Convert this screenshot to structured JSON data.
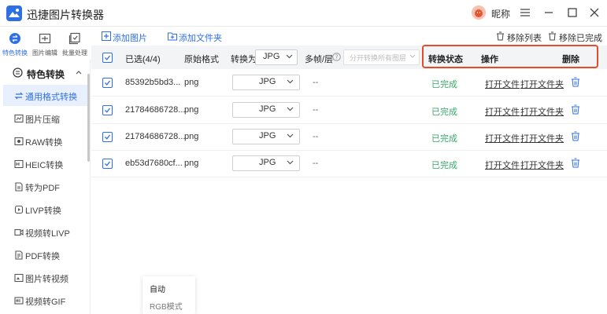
{
  "app": {
    "title": "迅捷图片转换器",
    "nickname": "昵称"
  },
  "colors": {
    "accent": "#2f6fe4",
    "success": "#38a86b",
    "highlight": "#e44b2c"
  },
  "top_nav": [
    {
      "label": "特色转换",
      "icon": "magic-convert-icon",
      "active": true
    },
    {
      "label": "图片编辑",
      "icon": "image-edit-icon",
      "active": false
    },
    {
      "label": "批量处理",
      "icon": "batch-process-icon",
      "active": false
    }
  ],
  "sidebar": {
    "section": "特色转换",
    "items": [
      {
        "label": "通用格式转换",
        "icon": "swap-icon"
      },
      {
        "label": "图片压缩",
        "icon": "compress-icon"
      },
      {
        "label": "RAW转换",
        "icon": "raw-icon"
      },
      {
        "label": "HEIC转换",
        "icon": "heic-icon"
      },
      {
        "label": "转为PDF",
        "icon": "pdf-icon"
      },
      {
        "label": "LIVP转换",
        "icon": "livp-icon"
      },
      {
        "label": "视频转LIVP",
        "icon": "video-icon"
      },
      {
        "label": "PDF转换",
        "icon": "pdf-convert-icon"
      },
      {
        "label": "图片转视频",
        "icon": "image-video-icon"
      },
      {
        "label": "视频转GIF",
        "icon": "gif-icon"
      }
    ]
  },
  "toolbar": {
    "add_image": "添加图片",
    "add_folder": "添加文件夹",
    "remove_list": "移除列表",
    "remove_done": "移除已完成"
  },
  "table": {
    "selected": "已选(4/4)",
    "col_format": "原始格式",
    "col_convert": "转换为",
    "convert_all_value": "JPG",
    "col_frames": "多帧/层",
    "frames_select": "分开转换所有图层",
    "col_status": "转换状态",
    "col_action": "操作",
    "col_delete": "删除",
    "rows": [
      {
        "name": "85392b5bd3...",
        "format": "png",
        "target": "JPG",
        "frames": "--",
        "status": "已完成",
        "open_file": "打开文件",
        "open_folder": "打开文件夹"
      },
      {
        "name": "21784686728...",
        "format": "png",
        "target": "JPG",
        "frames": "--",
        "status": "已完成",
        "open_file": "打开文件",
        "open_folder": "打开文件夹"
      },
      {
        "name": "21784686728...",
        "format": "png",
        "target": "JPG",
        "frames": "--",
        "status": "已完成",
        "open_file": "打开文件",
        "open_folder": "打开文件夹"
      },
      {
        "name": "eb53d7680cf...",
        "format": "png",
        "target": "JPG",
        "frames": "--",
        "status": "已完成",
        "open_file": "打开文件",
        "open_folder": "打开文件夹"
      }
    ]
  },
  "popup": {
    "options": [
      "自动",
      "RGB模式"
    ]
  }
}
